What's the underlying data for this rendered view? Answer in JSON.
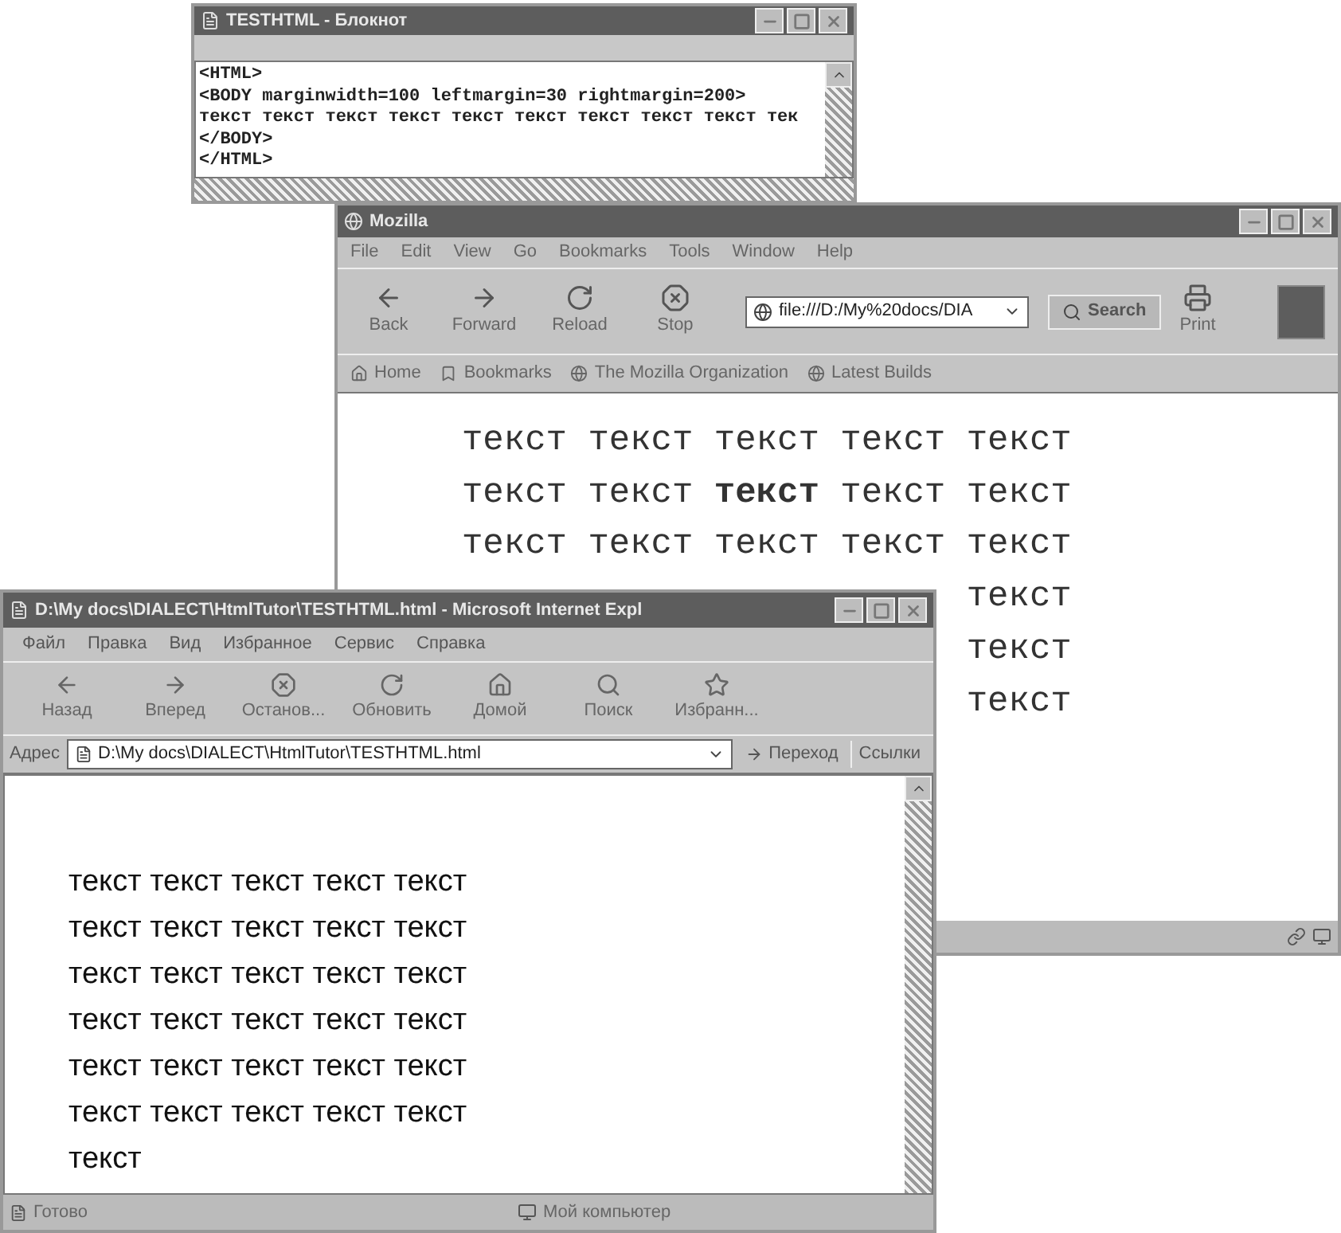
{
  "notepad": {
    "title": "TESTHTML - Блокнот",
    "lines": [
      "<HTML>",
      "<BODY marginwidth=100 leftmargin=30 rightmargin=200>",
      "текст текст текст текст текст текст текст текст текст тек",
      "</BODY>",
      "</HTML>"
    ]
  },
  "mozilla": {
    "title": "Mozilla",
    "menu": [
      "File",
      "Edit",
      "View",
      "Go",
      "Bookmarks",
      "Tools",
      "Window",
      "Help"
    ],
    "toolbar": [
      "Back",
      "Forward",
      "Reload",
      "Stop"
    ],
    "url": "file:///D:/My%20docs/DIA",
    "search": "Search",
    "print": "Print",
    "personal_toolbar": [
      "Home",
      "Bookmarks",
      "The Mozilla Organization",
      "Latest Builds"
    ],
    "content_lines": [
      "текст текст текст текст текст",
      "текст текст **текст** текст текст",
      "текст текст текст текст текст",
      "текст",
      "текст",
      "текст"
    ]
  },
  "ie": {
    "title": "D:\\My docs\\DIALECT\\HtmlTutor\\TESTHTML.html - Microsoft Internet Expl",
    "menu": [
      "Файл",
      "Правка",
      "Вид",
      "Избранное",
      "Сервис",
      "Справка"
    ],
    "toolbar": [
      "Назад",
      "Вперед",
      "Останов...",
      "Обновить",
      "Домой",
      "Поиск",
      "Избранн..."
    ],
    "address_label": "Адрес",
    "url": "D:\\My docs\\DIALECT\\HtmlTutor\\TESTHTML.html",
    "go": "Переход",
    "links": "Ссылки",
    "content_lines": [
      "текст текст текст текст текст",
      "текст текст текст текст текст",
      "текст текст текст текст текст",
      "текст текст текст текст текст",
      "текст текст текст текст текст",
      "текст текст текст текст текст",
      "текст"
    ],
    "status": "Готово",
    "zone": "Мой компьютер"
  }
}
